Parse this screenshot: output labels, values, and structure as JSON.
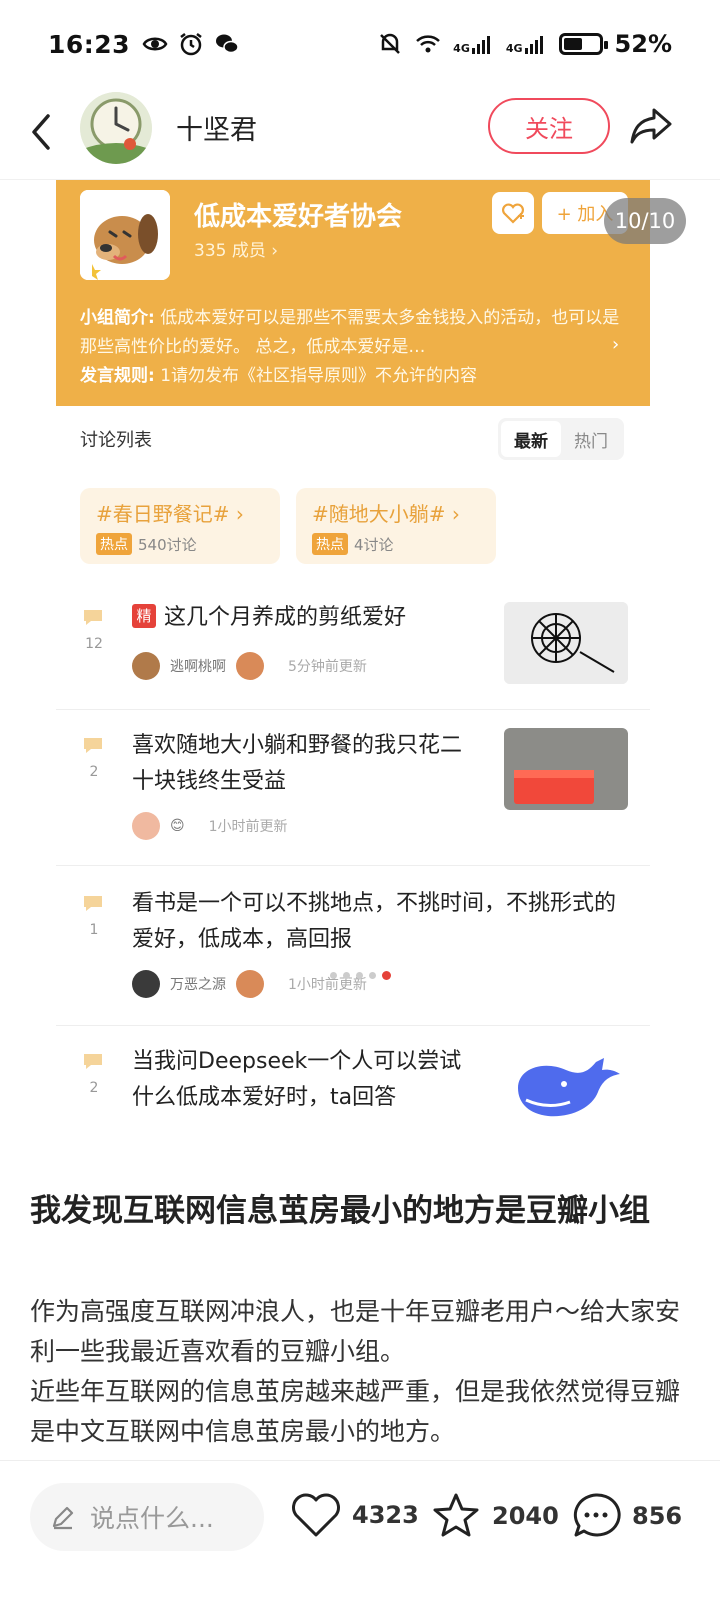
{
  "status_bar": {
    "time": "16:23",
    "net1": "4G",
    "net2": "4G",
    "battery": "52%",
    "battery_level": 0.52
  },
  "header": {
    "author": "十坚君",
    "follow_label": "关注"
  },
  "image_counter": "10/10",
  "embedded": {
    "group": {
      "name": "低成本爱好者协会",
      "members": "335 成员 ›",
      "join_label": "+ 加入",
      "intro_label": "小组简介:",
      "intro_text": "低成本爱好可以是那些不需要太多金钱投入的活动，也可以是那些高性价比的爱好。 总之，低成本爱好是…",
      "rules_label": "发言规则:",
      "rules_text": "1请勿发布《社区指导原则》不允许的内容"
    },
    "discussion_header": "讨论列表",
    "tabs": [
      {
        "label": "最新"
      },
      {
        "label": "热门"
      }
    ],
    "topics": [
      {
        "name": "#春日野餐记# ›",
        "badge": "热点",
        "count": "540讨论"
      },
      {
        "name": "#随地大小躺# ›",
        "badge": "热点",
        "count": "4讨论"
      }
    ],
    "posts": [
      {
        "badge": "精",
        "title": "这几个月养成的剪纸爱好",
        "comments": "12",
        "user": "逃啊桃啊",
        "time": "5分钟前更新"
      },
      {
        "title": "喜欢随地大小躺和野餐的我只花二十块钱终生受益",
        "comments": "2",
        "user": "😊",
        "time": "1小时前更新"
      },
      {
        "title": "看书是一个可以不挑地点，不挑时间，不挑形式的爱好，低成本，高回报",
        "comments": "1",
        "user": "万恶之源",
        "time": "1小时前更新"
      },
      {
        "title": "当我问Deepseek一个人可以尝试什么低成本爱好时，ta回答",
        "comments": "2"
      }
    ]
  },
  "carousel": {
    "total": 5,
    "active": 4
  },
  "article": {
    "title": "我发现互联网信息茧房最小的地方是豆瓣小组",
    "paragraphs": [
      "作为高强度互联网冲浪人，也是十年豆瓣老用户～给大家安利一些我最近喜欢看的豆瓣小组。",
      "近些年互联网的信息茧房越来越严重，但是我依然觉得豆瓣是中文互联网中信息茧房最小的地方。"
    ]
  },
  "bottom_bar": {
    "comment_placeholder": "说点什么...",
    "likes": "4323",
    "favorites": "2040",
    "comments": "856"
  },
  "colors": {
    "accent_red": "#f04a5c",
    "group_orange": "#efb048",
    "topic_orange": "#e8a23c"
  }
}
